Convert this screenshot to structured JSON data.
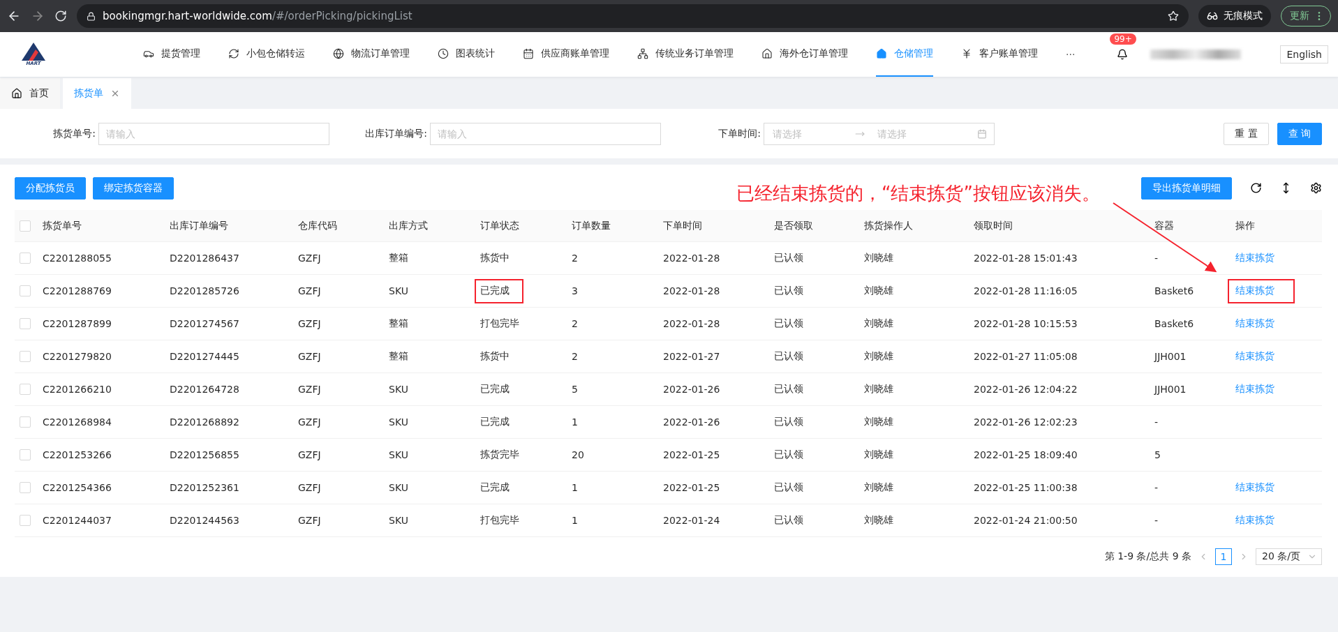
{
  "browser": {
    "url_host": "bookingmgr.hart-worldwide.com",
    "url_path": "/#/orderPicking/pickingList",
    "incognito_label": "无痕模式",
    "update_label": "更新"
  },
  "header": {
    "logo_text": "HART",
    "nav": [
      {
        "label": "提货管理",
        "selected": false
      },
      {
        "label": "小包仓储转运",
        "selected": false
      },
      {
        "label": "物流订单管理",
        "selected": false
      },
      {
        "label": "图表统计",
        "selected": false
      },
      {
        "label": "供应商账单管理",
        "selected": false
      },
      {
        "label": "传统业务订单管理",
        "selected": false
      },
      {
        "label": "海外仓订单管理",
        "selected": false
      },
      {
        "label": "仓储管理",
        "selected": true
      },
      {
        "label": "客户账单管理",
        "selected": false
      }
    ],
    "more": "···",
    "notification_badge": "99+",
    "language": "English"
  },
  "tabs": [
    {
      "label": "首页",
      "selected": false,
      "closable": false
    },
    {
      "label": "拣货单",
      "selected": true,
      "closable": true
    }
  ],
  "filters": [
    {
      "kind": "text",
      "label": "拣货单号:",
      "placeholder": "请输入"
    },
    {
      "kind": "text",
      "label": "出库订单编号:",
      "placeholder": "请输入"
    },
    {
      "kind": "daterange",
      "label": "下单时间:",
      "start_placeholder": "请选择",
      "end_placeholder": "请选择"
    }
  ],
  "filter_buttons": [
    {
      "label": "重 置",
      "primary": false
    },
    {
      "label": "查 询",
      "primary": true
    }
  ],
  "toolbar": {
    "left_buttons": [
      "分配拣货员",
      "绑定拣货容器"
    ],
    "export_button": "导出拣货单明细"
  },
  "annotation": {
    "text": "已经结束拣货的，“结束拣货”按钮应该消失。"
  },
  "table": {
    "all_checked": false,
    "columns": [
      "拣货单号",
      "出库订单编号",
      "仓库代码",
      "出库方式",
      "订单状态",
      "订单数量",
      "下单时间",
      "是否领取",
      "拣货操作人",
      "领取时间",
      "容器",
      "操作"
    ],
    "rows": [
      {
        "checked": false,
        "cells": [
          "C2201288055",
          "D2201286437",
          "GZFJ",
          "整箱",
          "拣货中",
          "2",
          "2022-01-28",
          "已认领",
          "刘晓雄",
          "2022-01-28 15:01:43",
          "-"
        ],
        "action": "结束拣货",
        "highlight_status": false,
        "highlight_action": false
      },
      {
        "checked": false,
        "cells": [
          "C2201288769",
          "D2201285726",
          "GZFJ",
          "SKU",
          "已完成",
          "3",
          "2022-01-28",
          "已认领",
          "刘晓雄",
          "2022-01-28 11:16:05",
          "Basket6"
        ],
        "action": "结束拣货",
        "highlight_status": true,
        "highlight_action": true
      },
      {
        "checked": false,
        "cells": [
          "C2201287899",
          "D2201274567",
          "GZFJ",
          "整箱",
          "打包完毕",
          "2",
          "2022-01-28",
          "已认领",
          "刘晓雄",
          "2022-01-28 10:15:53",
          "Basket6"
        ],
        "action": "结束拣货",
        "highlight_status": false,
        "highlight_action": false
      },
      {
        "checked": false,
        "cells": [
          "C2201279820",
          "D2201274445",
          "GZFJ",
          "整箱",
          "拣货中",
          "2",
          "2022-01-27",
          "已认领",
          "刘晓雄",
          "2022-01-27 11:05:08",
          "JJH001"
        ],
        "action": "结束拣货",
        "highlight_status": false,
        "highlight_action": false
      },
      {
        "checked": false,
        "cells": [
          "C2201266210",
          "D2201264728",
          "GZFJ",
          "SKU",
          "已完成",
          "5",
          "2022-01-26",
          "已认领",
          "刘晓雄",
          "2022-01-26 12:04:22",
          "JJH001"
        ],
        "action": "结束拣货",
        "highlight_status": false,
        "highlight_action": false
      },
      {
        "checked": false,
        "cells": [
          "C2201268984",
          "D2201268892",
          "GZFJ",
          "SKU",
          "已完成",
          "1",
          "2022-01-26",
          "已认领",
          "刘晓雄",
          "2022-01-26 12:02:23",
          "-"
        ],
        "highlight_status": false
      },
      {
        "checked": false,
        "cells": [
          "C2201253266",
          "D2201256855",
          "GZFJ",
          "SKU",
          "拣货完毕",
          "20",
          "2022-01-25",
          "已认领",
          "刘晓雄",
          "2022-01-25 18:09:40",
          "5"
        ],
        "highlight_status": false
      },
      {
        "checked": false,
        "cells": [
          "C2201254366",
          "D2201252361",
          "GZFJ",
          "SKU",
          "已完成",
          "1",
          "2022-01-25",
          "已认领",
          "刘晓雄",
          "2022-01-25 11:00:38",
          "-"
        ],
        "action": "结束拣货",
        "highlight_status": false,
        "highlight_action": false
      },
      {
        "checked": false,
        "cells": [
          "C2201244037",
          "D2201244563",
          "GZFJ",
          "SKU",
          "打包完毕",
          "1",
          "2022-01-24",
          "已认领",
          "刘晓雄",
          "2022-01-24 21:00:50",
          "-"
        ],
        "action": "结束拣货",
        "highlight_status": false,
        "highlight_action": false
      }
    ]
  },
  "pagination": {
    "summary": "第 1-9 条/总共 9 条",
    "pages": [
      {
        "label": "1",
        "selected": true
      }
    ],
    "page_size": "20 条/页"
  }
}
